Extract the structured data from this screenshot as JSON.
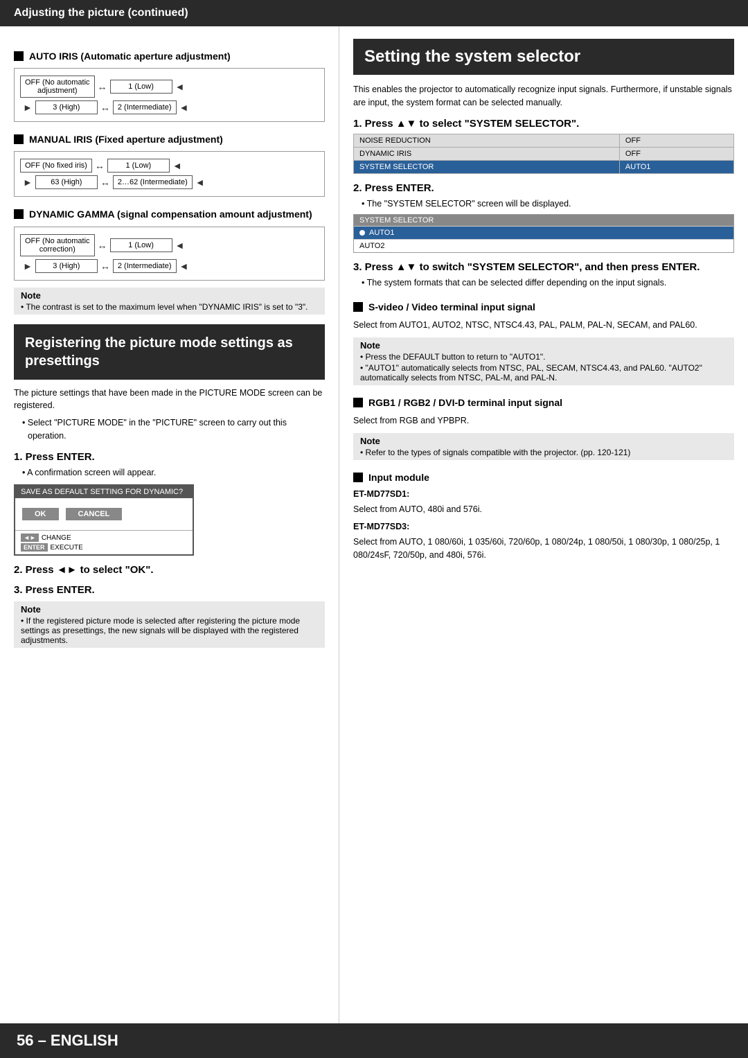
{
  "header": {
    "title": "Adjusting the picture (continued)"
  },
  "left": {
    "section1": {
      "title": "AUTO IRIS (Automatic aperture adjustment)",
      "diagram1": {
        "row1": [
          {
            "label": "OFF (No automatic\nadjustment)",
            "arrow": "↔",
            "label2": "1 (Low)"
          },
          {
            "arrow": "◄"
          }
        ],
        "row2": [
          {
            "arrow": "►",
            "label": "3 (High)",
            "arrow2": "↔",
            "label2": "2 (Intermediate)"
          },
          {
            "arrow": "◄"
          }
        ]
      }
    },
    "section2": {
      "title": "MANUAL IRIS (Fixed aperture adjustment)",
      "diagram2": {
        "row1_label1": "OFF (No fixed iris)",
        "row1_label2": "1 (Low)",
        "row2_label1": "63 (High)",
        "row2_label2": "2…62 (Intermediate)"
      }
    },
    "section3": {
      "title": "DYNAMIC GAMMA (signal compensation amount adjustment)",
      "diagram3": {
        "row1_label1": "OFF (No automatic\ncorrection)",
        "row1_label2": "1 (Low)",
        "row2_label1": "3 (High)",
        "row2_label2": "2 (Intermediate)"
      }
    },
    "note1": {
      "title": "Note",
      "text": "The contrast is set to the maximum level when \"DYNAMIC IRIS\" is set to \"3\"."
    },
    "large_section_title": "Registering the picture mode settings as presettings",
    "large_section_body": "The picture settings that have been made in the PICTURE MODE screen can be registered.",
    "bullet1": "Select \"PICTURE MODE\" in the \"PICTURE\" screen to carry out this operation.",
    "step1": {
      "heading": "1.  Press ENTER.",
      "bullet": "A confirmation screen will appear.",
      "dialog": {
        "title": "SAVE AS DEFAULT SETTING FOR DYNAMIC?",
        "btn_ok": "OK",
        "btn_cancel": "CANCEL",
        "footer1_icon": "◄►",
        "footer1_text": "CHANGE",
        "footer2_icon": "ENTER",
        "footer2_text": "EXECUTE"
      }
    },
    "step2": {
      "heading": "2.  Press ◄► to select \"OK\"."
    },
    "step3": {
      "heading": "3.  Press ENTER."
    },
    "note2": {
      "title": "Note",
      "text": "If the registered picture mode is selected after registering the picture mode settings as presettings, the new signals will be displayed with the registered adjustments."
    }
  },
  "right": {
    "title": "Setting the system selector",
    "intro": "This enables the projector to automatically recognize input signals. Furthermore, if unstable signals are input, the system format can be selected manually.",
    "step1": {
      "heading": "1.  Press ▲▼ to select \"SYSTEM SELECTOR\".",
      "table": {
        "rows": [
          {
            "col1": "NOISE REDUCTION",
            "col2": "OFF",
            "highlight": false
          },
          {
            "col1": "DYNAMIC IRIS",
            "col2": "OFF",
            "highlight": false
          },
          {
            "col1": "SYSTEM SELECTOR",
            "col2": "AUTO1",
            "highlight": true
          }
        ]
      }
    },
    "step2": {
      "heading": "2.  Press ENTER.",
      "bullet": "The \"SYSTEM SELECTOR\" screen will be displayed.",
      "selector": {
        "title": "SYSTEM SELECTOR",
        "items": [
          {
            "label": "AUTO1",
            "selected": true,
            "has_bullet": true
          },
          {
            "label": "AUTO2",
            "selected": false,
            "has_bullet": false
          }
        ]
      }
    },
    "step3": {
      "heading": "3.  Press ▲▼ to switch \"SYSTEM SELECTOR\", and then press ENTER.",
      "bullet": "The system formats that can be selected differ depending on the input signals."
    },
    "section_svideo": {
      "title": "S-video / Video terminal input signal",
      "body": "Select from AUTO1, AUTO2, NTSC, NTSC4.43, PAL, PALM, PAL-N, SECAM, and PAL60."
    },
    "note3": {
      "title": "Note",
      "bullets": [
        "Press the DEFAULT button to return to \"AUTO1\".",
        "\"AUTO1\" automatically selects from NTSC, PAL, SECAM, NTSC4.43, and PAL60. \"AUTO2\" automatically selects from NTSC, PAL-M, and PAL-N."
      ]
    },
    "section_rgb": {
      "title": "RGB1 / RGB2 / DVI-D terminal input signal",
      "body": "Select from RGB and YPBPR."
    },
    "note4": {
      "title": "Note",
      "bullet": "Refer to the types of signals compatible with the projector. (pp. 120-121)"
    },
    "section_input": {
      "title": "Input module",
      "sub1": {
        "label": "ET-MD77SD1:",
        "text": "Select from AUTO, 480i and 576i."
      },
      "sub2": {
        "label": "ET-MD77SD3:",
        "text": "Select from AUTO, 1 080/60i, 1 035/60i, 720/60p, 1 080/24p, 1 080/50i, 1 080/30p, 1 080/25p, 1 080/24sF, 720/50p, and 480i, 576i."
      }
    }
  },
  "footer": {
    "text": "56 – ENGLISH"
  }
}
